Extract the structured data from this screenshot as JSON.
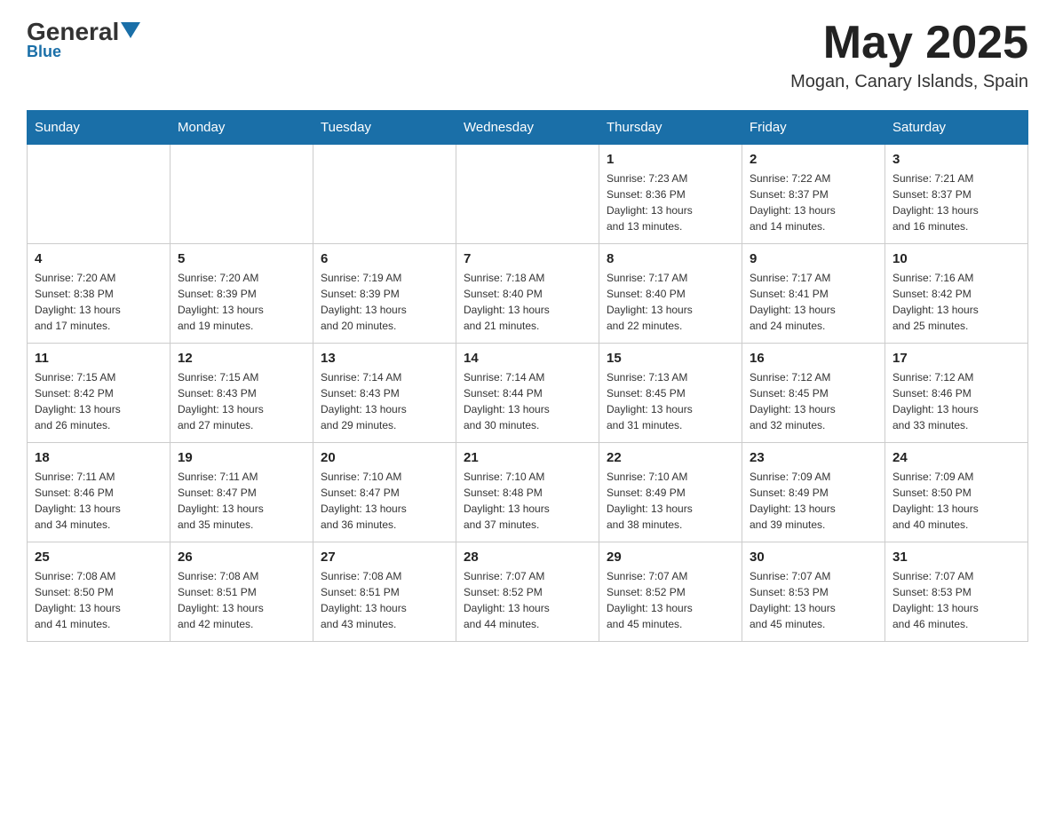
{
  "header": {
    "logo_general": "General",
    "logo_blue": "Blue",
    "month_year": "May 2025",
    "location": "Mogan, Canary Islands, Spain"
  },
  "weekdays": [
    "Sunday",
    "Monday",
    "Tuesday",
    "Wednesday",
    "Thursday",
    "Friday",
    "Saturday"
  ],
  "weeks": [
    [
      {
        "day": "",
        "info": ""
      },
      {
        "day": "",
        "info": ""
      },
      {
        "day": "",
        "info": ""
      },
      {
        "day": "",
        "info": ""
      },
      {
        "day": "1",
        "info": "Sunrise: 7:23 AM\nSunset: 8:36 PM\nDaylight: 13 hours\nand 13 minutes."
      },
      {
        "day": "2",
        "info": "Sunrise: 7:22 AM\nSunset: 8:37 PM\nDaylight: 13 hours\nand 14 minutes."
      },
      {
        "day": "3",
        "info": "Sunrise: 7:21 AM\nSunset: 8:37 PM\nDaylight: 13 hours\nand 16 minutes."
      }
    ],
    [
      {
        "day": "4",
        "info": "Sunrise: 7:20 AM\nSunset: 8:38 PM\nDaylight: 13 hours\nand 17 minutes."
      },
      {
        "day": "5",
        "info": "Sunrise: 7:20 AM\nSunset: 8:39 PM\nDaylight: 13 hours\nand 19 minutes."
      },
      {
        "day": "6",
        "info": "Sunrise: 7:19 AM\nSunset: 8:39 PM\nDaylight: 13 hours\nand 20 minutes."
      },
      {
        "day": "7",
        "info": "Sunrise: 7:18 AM\nSunset: 8:40 PM\nDaylight: 13 hours\nand 21 minutes."
      },
      {
        "day": "8",
        "info": "Sunrise: 7:17 AM\nSunset: 8:40 PM\nDaylight: 13 hours\nand 22 minutes."
      },
      {
        "day": "9",
        "info": "Sunrise: 7:17 AM\nSunset: 8:41 PM\nDaylight: 13 hours\nand 24 minutes."
      },
      {
        "day": "10",
        "info": "Sunrise: 7:16 AM\nSunset: 8:42 PM\nDaylight: 13 hours\nand 25 minutes."
      }
    ],
    [
      {
        "day": "11",
        "info": "Sunrise: 7:15 AM\nSunset: 8:42 PM\nDaylight: 13 hours\nand 26 minutes."
      },
      {
        "day": "12",
        "info": "Sunrise: 7:15 AM\nSunset: 8:43 PM\nDaylight: 13 hours\nand 27 minutes."
      },
      {
        "day": "13",
        "info": "Sunrise: 7:14 AM\nSunset: 8:43 PM\nDaylight: 13 hours\nand 29 minutes."
      },
      {
        "day": "14",
        "info": "Sunrise: 7:14 AM\nSunset: 8:44 PM\nDaylight: 13 hours\nand 30 minutes."
      },
      {
        "day": "15",
        "info": "Sunrise: 7:13 AM\nSunset: 8:45 PM\nDaylight: 13 hours\nand 31 minutes."
      },
      {
        "day": "16",
        "info": "Sunrise: 7:12 AM\nSunset: 8:45 PM\nDaylight: 13 hours\nand 32 minutes."
      },
      {
        "day": "17",
        "info": "Sunrise: 7:12 AM\nSunset: 8:46 PM\nDaylight: 13 hours\nand 33 minutes."
      }
    ],
    [
      {
        "day": "18",
        "info": "Sunrise: 7:11 AM\nSunset: 8:46 PM\nDaylight: 13 hours\nand 34 minutes."
      },
      {
        "day": "19",
        "info": "Sunrise: 7:11 AM\nSunset: 8:47 PM\nDaylight: 13 hours\nand 35 minutes."
      },
      {
        "day": "20",
        "info": "Sunrise: 7:10 AM\nSunset: 8:47 PM\nDaylight: 13 hours\nand 36 minutes."
      },
      {
        "day": "21",
        "info": "Sunrise: 7:10 AM\nSunset: 8:48 PM\nDaylight: 13 hours\nand 37 minutes."
      },
      {
        "day": "22",
        "info": "Sunrise: 7:10 AM\nSunset: 8:49 PM\nDaylight: 13 hours\nand 38 minutes."
      },
      {
        "day": "23",
        "info": "Sunrise: 7:09 AM\nSunset: 8:49 PM\nDaylight: 13 hours\nand 39 minutes."
      },
      {
        "day": "24",
        "info": "Sunrise: 7:09 AM\nSunset: 8:50 PM\nDaylight: 13 hours\nand 40 minutes."
      }
    ],
    [
      {
        "day": "25",
        "info": "Sunrise: 7:08 AM\nSunset: 8:50 PM\nDaylight: 13 hours\nand 41 minutes."
      },
      {
        "day": "26",
        "info": "Sunrise: 7:08 AM\nSunset: 8:51 PM\nDaylight: 13 hours\nand 42 minutes."
      },
      {
        "day": "27",
        "info": "Sunrise: 7:08 AM\nSunset: 8:51 PM\nDaylight: 13 hours\nand 43 minutes."
      },
      {
        "day": "28",
        "info": "Sunrise: 7:07 AM\nSunset: 8:52 PM\nDaylight: 13 hours\nand 44 minutes."
      },
      {
        "day": "29",
        "info": "Sunrise: 7:07 AM\nSunset: 8:52 PM\nDaylight: 13 hours\nand 45 minutes."
      },
      {
        "day": "30",
        "info": "Sunrise: 7:07 AM\nSunset: 8:53 PM\nDaylight: 13 hours\nand 45 minutes."
      },
      {
        "day": "31",
        "info": "Sunrise: 7:07 AM\nSunset: 8:53 PM\nDaylight: 13 hours\nand 46 minutes."
      }
    ]
  ]
}
